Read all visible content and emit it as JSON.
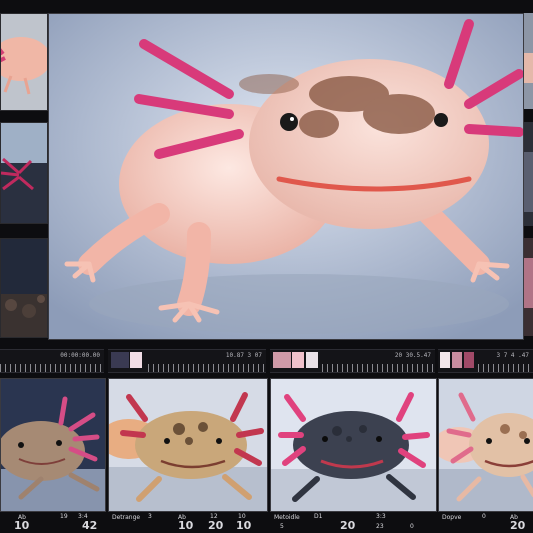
{
  "rulers": [
    {
      "readout": "00:00:00.00"
    },
    {
      "readout": "10.87 3 07"
    },
    {
      "readout": "20 30.5.47"
    },
    {
      "readout": "3 7 4 .47"
    }
  ],
  "captions": [
    {
      "name": "Ab",
      "left_num": "10",
      "nums": [
        "19",
        "3:4",
        "42"
      ]
    },
    {
      "name": "Detrange",
      "left_num": "3",
      "mid_name": "Ab",
      "nums": [
        "10",
        "20",
        "10"
      ],
      "num_tail": [
        "12",
        "10"
      ]
    },
    {
      "name": "Metoidle",
      "left_num": "5",
      "nums": [
        "D1",
        "20",
        "3:3",
        "23",
        "0"
      ]
    },
    {
      "name": "Dopve",
      "left_num": "0",
      "nums": [
        "Ab",
        "20"
      ]
    }
  ],
  "colors": {
    "background": "#0d0d10",
    "axolotl_pink": "#f7c9c2",
    "gill_magenta": "#d83a7a",
    "studio_blue": "#c9d3e6"
  }
}
